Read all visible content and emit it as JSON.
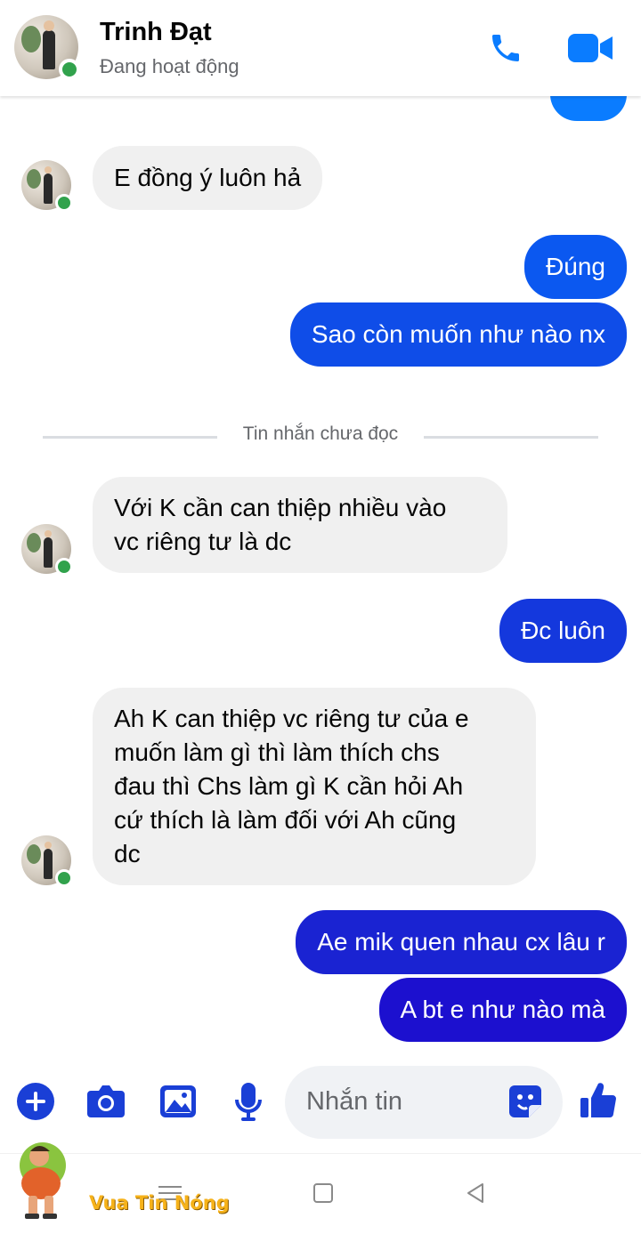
{
  "header": {
    "name": "Trinh Đạt",
    "status": "Đang hoạt động",
    "icons": [
      "phone-icon",
      "video-call-icon"
    ]
  },
  "colors": {
    "accent": "#0a7cff",
    "outgoing_bubble_top": "#0a7cff",
    "outgoing_bubble_bottom": "#1c0fd0",
    "incoming_bubble": "#f0f0f0",
    "online": "#31a24c"
  },
  "messages": [
    {
      "from": "them",
      "text": "E đồng ý luôn hả"
    },
    {
      "from": "me",
      "text": "Đúng"
    },
    {
      "from": "me",
      "text": "Sao còn muốn như nào nx"
    },
    {
      "from": "them",
      "lines": [
        "Với K cần can thiệp nhiều vào",
        "vc riêng tư là dc"
      ]
    },
    {
      "from": "me",
      "text": "Đc luôn"
    },
    {
      "from": "them",
      "lines": [
        "Ah K can thiệp vc riêng tư của e",
        "muốn làm gì thì làm thích chs",
        "đau thì Chs làm gì K cần hỏi Ah",
        "cứ thích là làm đối với Ah cũng",
        "dc"
      ]
    },
    {
      "from": "me",
      "text": "Ae mik quen nhau cx lâu r"
    },
    {
      "from": "me",
      "text": "A bt e như nào mà"
    }
  ],
  "divider": {
    "label": "Tin nhắn chưa đọc"
  },
  "composer": {
    "placeholder": "Nhắn tin",
    "icons": [
      "add-icon",
      "camera-icon",
      "gallery-icon",
      "microphone-icon",
      "sticker-icon",
      "like-icon"
    ]
  },
  "watermark": {
    "text": "Vua Tin Nóng"
  }
}
